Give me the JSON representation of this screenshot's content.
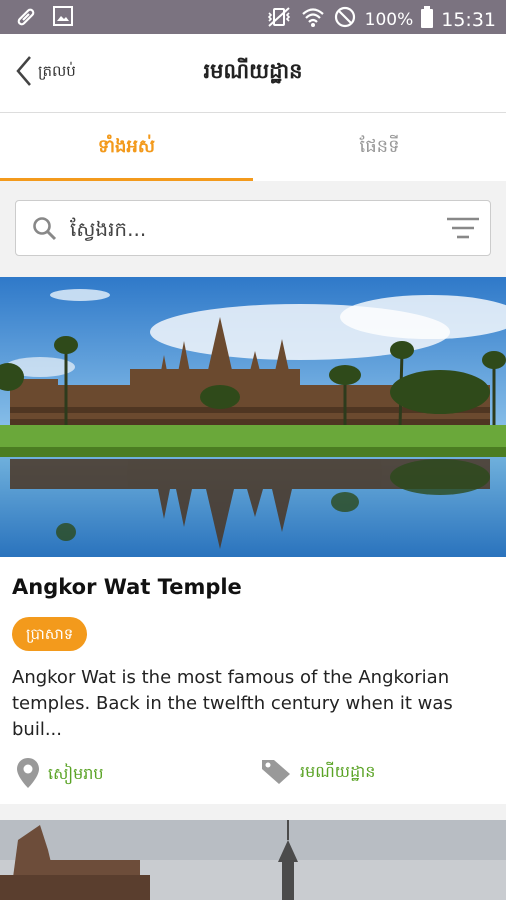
{
  "status": {
    "battery": "100%",
    "time": "15:31"
  },
  "header": {
    "back_label": "ត្រលប់",
    "title": "រមណីយដ្ឋាន"
  },
  "tabs": [
    {
      "label": "ទាំងអស់",
      "active": true
    },
    {
      "label": "ផែនទី",
      "active": false
    }
  ],
  "search": {
    "placeholder": "ស្វែងរក..."
  },
  "places": [
    {
      "title": "Angkor Wat Temple",
      "badge": "ប្រាសាទ",
      "description": "Angkor Wat is the most famous of the Angkorian temples. Back in the twelfth century when it was buil...",
      "location": "សៀមរាប",
      "category": "រមណីយដ្ឋាន"
    }
  ],
  "colors": {
    "accent": "#f39a1c",
    "green": "#5aa325",
    "statusbar": "#7b7380"
  }
}
